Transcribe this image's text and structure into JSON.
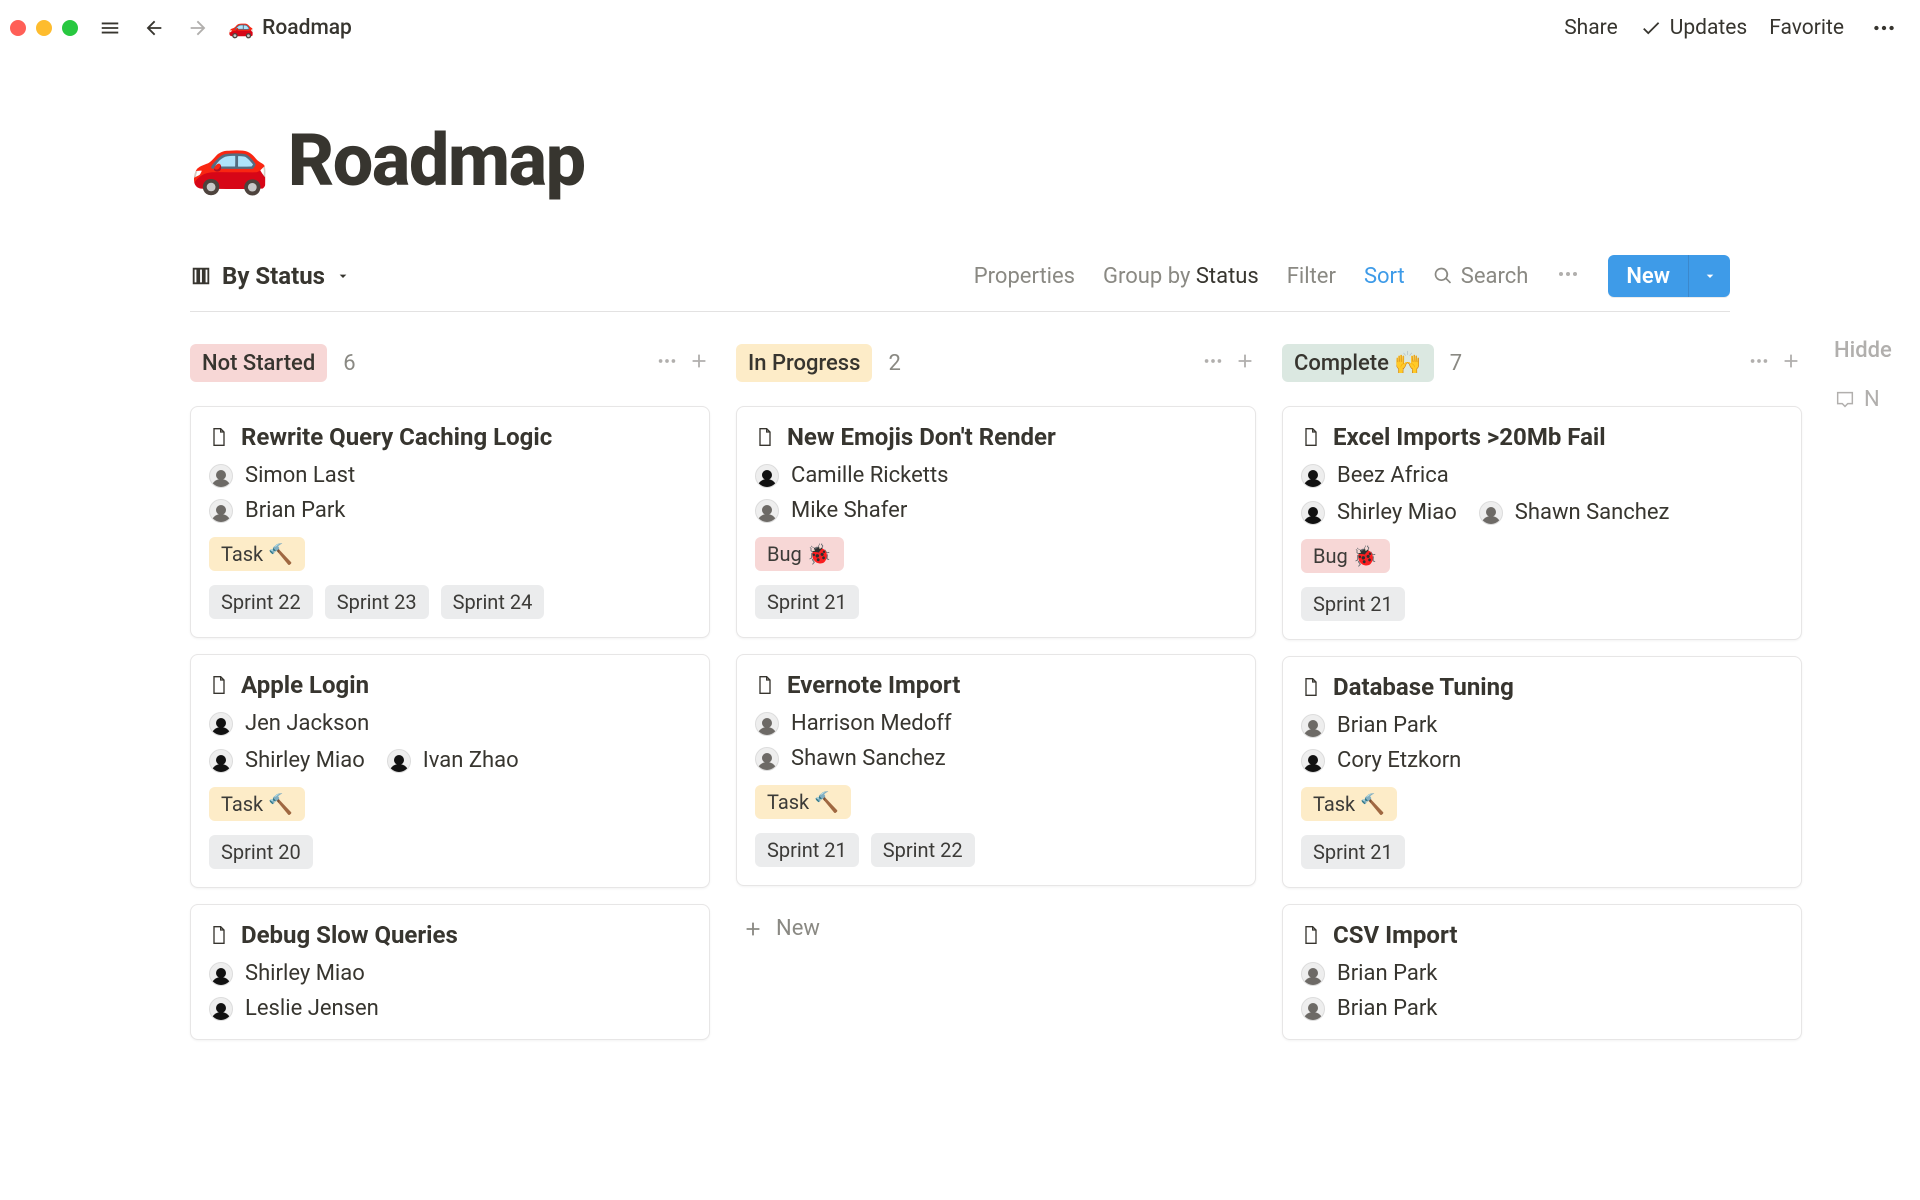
{
  "window": {
    "breadcrumb_icon": "🚗",
    "breadcrumb_title": "Roadmap"
  },
  "topbar": {
    "share": "Share",
    "updates": "Updates",
    "favorite": "Favorite"
  },
  "page": {
    "icon": "🚗",
    "title": "Roadmap"
  },
  "toolbar": {
    "view_label": "By Status",
    "properties": "Properties",
    "group_by_label": "Group by ",
    "group_by_value": "Status",
    "filter": "Filter",
    "sort": "Sort",
    "search": "Search",
    "new": "New"
  },
  "board": {
    "hidden_label": "Hidde",
    "hidden_inbox_label": "N",
    "add_new_label": "New",
    "columns": [
      {
        "id": "not_started",
        "label": "Not Started",
        "count": "6",
        "tag_class": "notstarted",
        "cards": [
          {
            "title": "Rewrite Query Caching Logic",
            "people": [
              {
                "name": "Simon Last"
              },
              {
                "name": "Brian Park"
              }
            ],
            "type_tag": {
              "label": "Task 🔨",
              "color": "yellow"
            },
            "sprint_tags": [
              "Sprint 22",
              "Sprint 23",
              "Sprint 24"
            ]
          },
          {
            "title": "Apple Login",
            "people_row1": [
              {
                "name": "Jen Jackson",
                "dark": true
              }
            ],
            "people_row2": [
              {
                "name": "Shirley Miao",
                "dark": true
              },
              {
                "name": "Ivan Zhao",
                "dark": true
              }
            ],
            "type_tag": {
              "label": "Task 🔨",
              "color": "yellow"
            },
            "sprint_tags": [
              "Sprint 20"
            ]
          },
          {
            "title": "Debug Slow Queries",
            "people": [
              {
                "name": "Shirley Miao",
                "dark": true
              },
              {
                "name": "Leslie Jensen",
                "dark": true
              }
            ]
          }
        ]
      },
      {
        "id": "in_progress",
        "label": "In Progress",
        "count": "2",
        "tag_class": "inprogress",
        "cards": [
          {
            "title": "New Emojis Don't Render",
            "people": [
              {
                "name": "Camille Ricketts",
                "dark": true
              },
              {
                "name": "Mike Shafer"
              }
            ],
            "type_tag": {
              "label": "Bug 🐞",
              "color": "red"
            },
            "sprint_tags": [
              "Sprint 21"
            ]
          },
          {
            "title": "Evernote Import",
            "people": [
              {
                "name": "Harrison Medoff"
              },
              {
                "name": "Shawn Sanchez"
              }
            ],
            "type_tag": {
              "label": "Task 🔨",
              "color": "yellow"
            },
            "sprint_tags": [
              "Sprint 21",
              "Sprint 22"
            ]
          }
        ],
        "show_add_new": true
      },
      {
        "id": "complete",
        "label": "Complete 🙌",
        "count": "7",
        "tag_class": "complete",
        "cards": [
          {
            "title": "Excel Imports >20Mb Fail",
            "people_row1": [
              {
                "name": "Beez Africa",
                "dark": true
              }
            ],
            "people_row2": [
              {
                "name": "Shirley Miao",
                "dark": true
              },
              {
                "name": "Shawn Sanchez"
              }
            ],
            "type_tag": {
              "label": "Bug 🐞",
              "color": "red"
            },
            "sprint_tags": [
              "Sprint 21"
            ]
          },
          {
            "title": "Database Tuning",
            "people": [
              {
                "name": "Brian Park"
              },
              {
                "name": "Cory Etzkorn",
                "dark": true
              }
            ],
            "type_tag": {
              "label": "Task 🔨",
              "color": "yellow"
            },
            "sprint_tags": [
              "Sprint 21"
            ]
          },
          {
            "title": "CSV Import",
            "people": [
              {
                "name": "Brian Park"
              },
              {
                "name": "Brian Park"
              }
            ]
          }
        ]
      }
    ]
  }
}
